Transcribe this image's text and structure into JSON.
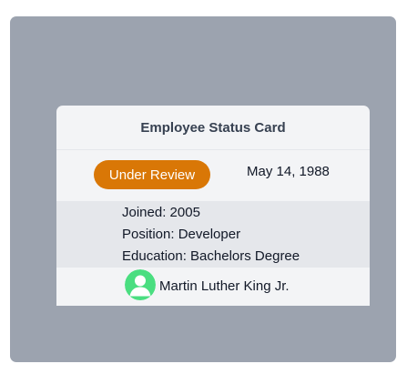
{
  "card": {
    "title": "Employee Status Card",
    "status": {
      "label": "Under Review",
      "color": "#d97706"
    },
    "date": "May 14, 1988",
    "details": {
      "joined": "Joined: 2005",
      "position": "Position: Developer",
      "education": "Education: Bachelors Degree"
    },
    "person": {
      "name": "Martin Luther King Jr.",
      "avatar_icon": "user-avatar-icon",
      "avatar_color": "#4ade80"
    }
  },
  "colors": {
    "frame_background": "#9ca3af",
    "card_background": "#f3f4f6",
    "details_background": "#e5e7eb"
  }
}
